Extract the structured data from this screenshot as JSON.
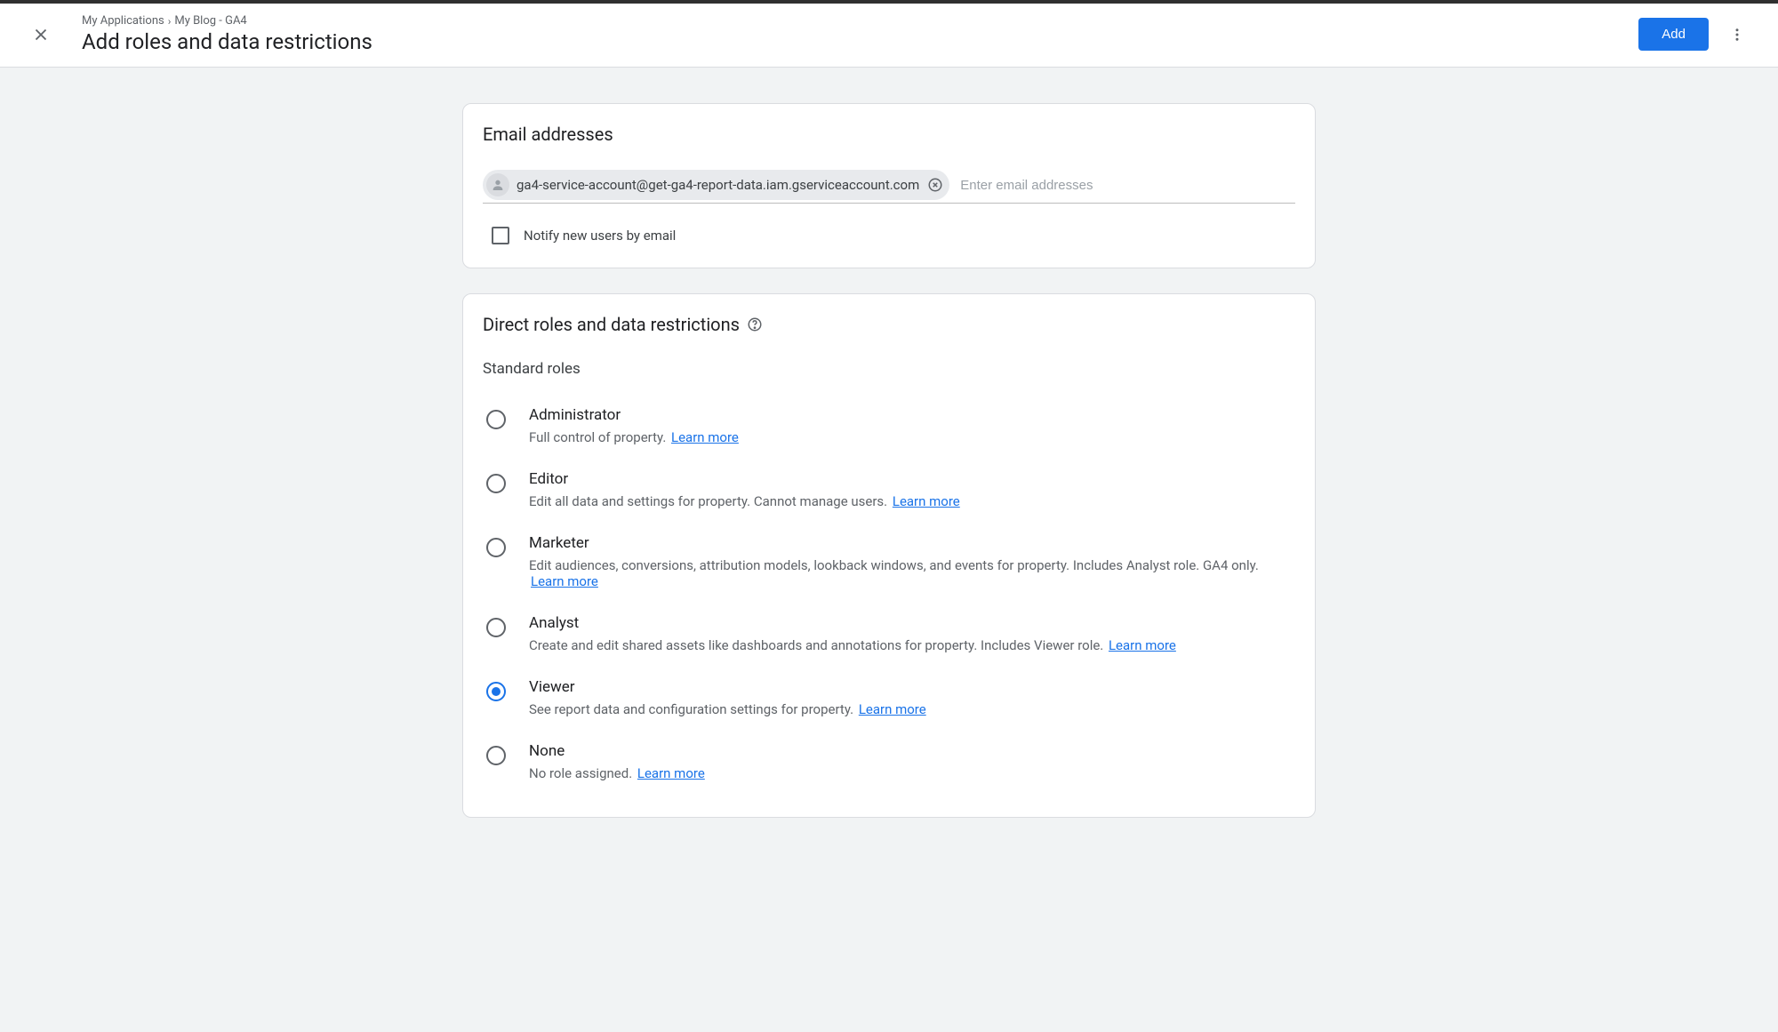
{
  "breadcrumb": {
    "part1": "My Applications",
    "part2": "My Blog - GA4"
  },
  "page_title": "Add roles and data restrictions",
  "add_button": "Add",
  "email_section": {
    "title": "Email addresses",
    "chip_email": "ga4-service-account@get-ga4-report-data.iam.gserviceaccount.com",
    "placeholder": "Enter email addresses",
    "notify_label": "Notify new users by email"
  },
  "roles_section": {
    "title": "Direct roles and data restrictions",
    "subhead": "Standard roles",
    "learn_more": "Learn more",
    "roles": [
      {
        "title": "Administrator",
        "desc": "Full control of property.",
        "selected": false
      },
      {
        "title": "Editor",
        "desc": "Edit all data and settings for property. Cannot manage users.",
        "selected": false
      },
      {
        "title": "Marketer",
        "desc": "Edit audiences, conversions, attribution models, lookback windows, and events for property. Includes Analyst role. GA4 only.",
        "selected": false
      },
      {
        "title": "Analyst",
        "desc": "Create and edit shared assets like dashboards and annotations for property. Includes Viewer role.",
        "selected": false
      },
      {
        "title": "Viewer",
        "desc": "See report data and configuration settings for property.",
        "selected": true
      },
      {
        "title": "None",
        "desc": "No role assigned.",
        "selected": false
      }
    ]
  }
}
